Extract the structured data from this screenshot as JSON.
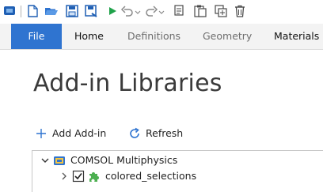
{
  "quick_access": {
    "icons": [
      "app-icon",
      "new-icon",
      "open-icon",
      "save-icon",
      "save-as-icon",
      "run-icon",
      "undo-icon",
      "redo-icon",
      "copy-icon",
      "paste-icon",
      "duplicate-icon",
      "delete-icon"
    ]
  },
  "ribbon": {
    "tabs": [
      {
        "label": "File"
      },
      {
        "label": "Home"
      },
      {
        "label": "Definitions"
      },
      {
        "label": "Geometry"
      },
      {
        "label": "Materials"
      }
    ]
  },
  "page": {
    "title": "Add-in Libraries"
  },
  "actions": {
    "add_label": "Add Add-in",
    "refresh_label": "Refresh"
  },
  "tree": {
    "root": {
      "label": "COMSOL Multiphysics",
      "expanded": true
    },
    "items": [
      {
        "label": "colored_selections",
        "checked": true,
        "expanded": false
      }
    ]
  },
  "colors": {
    "file_tab_bg": "#2f74d0",
    "accent_blue": "#2f74d0",
    "puzzle_green": "#4caf50"
  }
}
